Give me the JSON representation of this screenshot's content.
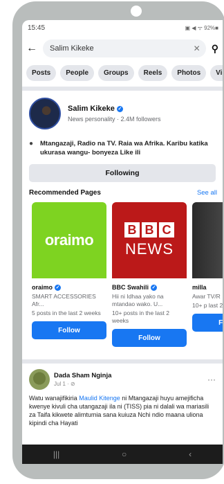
{
  "status": {
    "time": "15:45",
    "icons": "▣ ◀ ᯤ 92%■"
  },
  "search": {
    "value": "Salim Kikeke"
  },
  "chips": [
    "Posts",
    "People",
    "Groups",
    "Reels",
    "Photos",
    "Vid"
  ],
  "profile": {
    "name": "Salim Kikeke",
    "subtitle": "News personality · 2.4M followers",
    "bio": "Mtangazaji, Radio na TV. Raia wa Afrika. Karibu katika ukurasa wangu- bonyeza Like ili",
    "following_label": "Following"
  },
  "recommended": {
    "title": "Recommended Pages",
    "see_all": "See all",
    "cards": [
      {
        "name": "oraimo",
        "desc": "SMART ACCESSORIES Afr...",
        "posts": "5 posts in the last 2 weeks",
        "logo": "oraimo",
        "follow": "Follow"
      },
      {
        "name": "BBC Swahili",
        "desc": "Hii ni Idhaa yako na mtandao wako. U...",
        "posts": "10+ posts in the last 2 weeks",
        "logo_top": "BBC",
        "logo_bottom": "NEWS",
        "follow": "Follow"
      },
      {
        "name": "milla",
        "desc": "Awar TV/R",
        "posts": "10+ p last 2",
        "follow": "Follow"
      }
    ]
  },
  "post": {
    "author": "Dada Sham Nginja",
    "date": "Jul 1 · ⊘",
    "text_a": "Watu wanajifikiria ",
    "link": "Maulid Kitenge",
    "text_b": " ni Mtangazaji  huyu amejificha kwenye kivuli cha utangazaji ila ni (TISS) pia ni dalali wa mariasili za Taifa  kikwete alimtumia sana kuiuza Nchi  ndio maana uliona kipindi cha  Hayati"
  },
  "navbar": {
    "recent": "|||",
    "home": "○",
    "back": "‹"
  }
}
